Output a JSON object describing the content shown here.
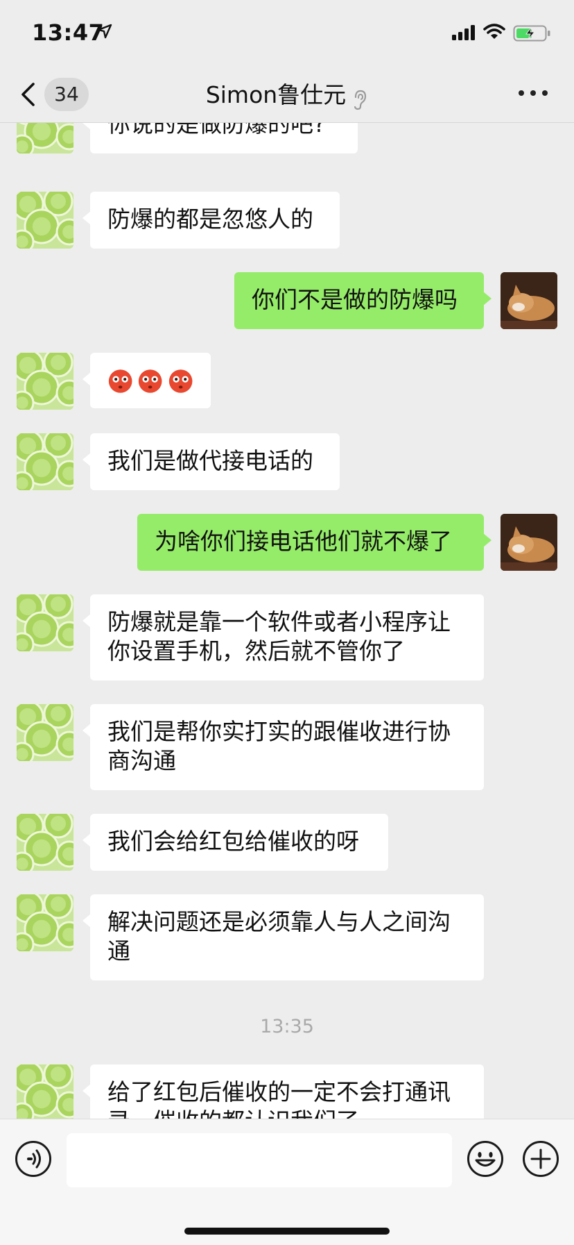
{
  "status_bar": {
    "time": "13:47",
    "icons": [
      "location-arrow-icon",
      "signal-icon",
      "wifi-icon",
      "battery-charging-icon"
    ]
  },
  "nav": {
    "back_icon": "chevron-left-icon",
    "unread_count": "34",
    "title": "Simon鲁仕元",
    "title_icon": "ear-icon",
    "more_icon": "more-dots-icon"
  },
  "messages": [
    {
      "side": "in",
      "text": "你说的是做防爆的吧?"
    },
    {
      "side": "in",
      "text": "防爆的都是忽悠人的"
    },
    {
      "side": "out",
      "text": "你们不是做的防爆吗"
    },
    {
      "side": "in",
      "emoji": [
        "flushed-emoji",
        "flushed-emoji",
        "flushed-emoji"
      ]
    },
    {
      "side": "in",
      "text": "我们是做代接电话的"
    },
    {
      "side": "out",
      "text": "为啥你们接电话他们就不爆了"
    },
    {
      "side": "in",
      "text": "防爆就是靠一个软件或者小程序让你设置手机，然后就不管你了"
    },
    {
      "side": "in",
      "text": "我们是帮你实打实的跟催收进行协商沟通"
    },
    {
      "side": "in",
      "text": "我们会给红包给催收的呀"
    },
    {
      "side": "in",
      "text": "解决问题还是必须靠人与人之间沟通"
    },
    {
      "side": "in",
      "text": "给了红包后催收的一定不会打通讯录，催收的都认识我们了"
    }
  ],
  "time_separator": "13:35",
  "input_bar": {
    "value": "",
    "voice_icon": "voice-icon",
    "emoji_icon": "emoji-face-icon",
    "plus_icon": "plus-icon"
  },
  "colors": {
    "background": "#ededed",
    "outgoing_bubble": "#95ec69",
    "incoming_bubble": "#ffffff"
  }
}
